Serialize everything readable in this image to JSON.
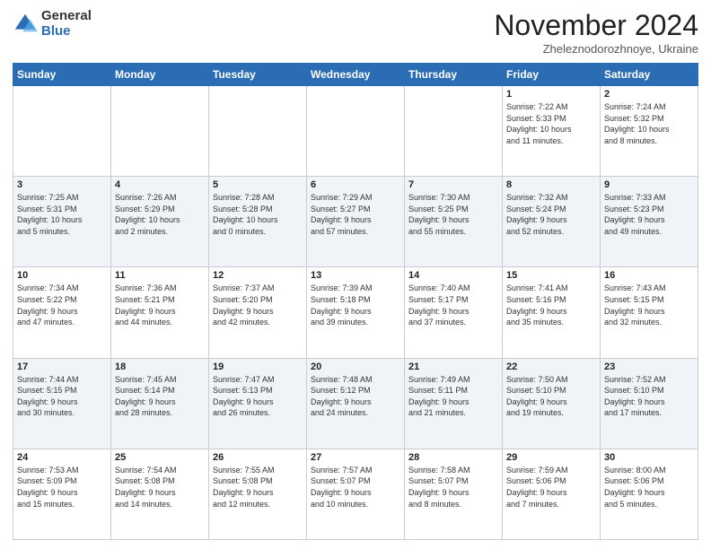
{
  "header": {
    "logo_general": "General",
    "logo_blue": "Blue",
    "month_title": "November 2024",
    "location": "Zheleznodorozhnoye, Ukraine"
  },
  "days_of_week": [
    "Sunday",
    "Monday",
    "Tuesday",
    "Wednesday",
    "Thursday",
    "Friday",
    "Saturday"
  ],
  "weeks": [
    [
      {
        "day": "",
        "info": ""
      },
      {
        "day": "",
        "info": ""
      },
      {
        "day": "",
        "info": ""
      },
      {
        "day": "",
        "info": ""
      },
      {
        "day": "",
        "info": ""
      },
      {
        "day": "1",
        "info": "Sunrise: 7:22 AM\nSunset: 5:33 PM\nDaylight: 10 hours\nand 11 minutes."
      },
      {
        "day": "2",
        "info": "Sunrise: 7:24 AM\nSunset: 5:32 PM\nDaylight: 10 hours\nand 8 minutes."
      }
    ],
    [
      {
        "day": "3",
        "info": "Sunrise: 7:25 AM\nSunset: 5:31 PM\nDaylight: 10 hours\nand 5 minutes."
      },
      {
        "day": "4",
        "info": "Sunrise: 7:26 AM\nSunset: 5:29 PM\nDaylight: 10 hours\nand 2 minutes."
      },
      {
        "day": "5",
        "info": "Sunrise: 7:28 AM\nSunset: 5:28 PM\nDaylight: 10 hours\nand 0 minutes."
      },
      {
        "day": "6",
        "info": "Sunrise: 7:29 AM\nSunset: 5:27 PM\nDaylight: 9 hours\nand 57 minutes."
      },
      {
        "day": "7",
        "info": "Sunrise: 7:30 AM\nSunset: 5:25 PM\nDaylight: 9 hours\nand 55 minutes."
      },
      {
        "day": "8",
        "info": "Sunrise: 7:32 AM\nSunset: 5:24 PM\nDaylight: 9 hours\nand 52 minutes."
      },
      {
        "day": "9",
        "info": "Sunrise: 7:33 AM\nSunset: 5:23 PM\nDaylight: 9 hours\nand 49 minutes."
      }
    ],
    [
      {
        "day": "10",
        "info": "Sunrise: 7:34 AM\nSunset: 5:22 PM\nDaylight: 9 hours\nand 47 minutes."
      },
      {
        "day": "11",
        "info": "Sunrise: 7:36 AM\nSunset: 5:21 PM\nDaylight: 9 hours\nand 44 minutes."
      },
      {
        "day": "12",
        "info": "Sunrise: 7:37 AM\nSunset: 5:20 PM\nDaylight: 9 hours\nand 42 minutes."
      },
      {
        "day": "13",
        "info": "Sunrise: 7:39 AM\nSunset: 5:18 PM\nDaylight: 9 hours\nand 39 minutes."
      },
      {
        "day": "14",
        "info": "Sunrise: 7:40 AM\nSunset: 5:17 PM\nDaylight: 9 hours\nand 37 minutes."
      },
      {
        "day": "15",
        "info": "Sunrise: 7:41 AM\nSunset: 5:16 PM\nDaylight: 9 hours\nand 35 minutes."
      },
      {
        "day": "16",
        "info": "Sunrise: 7:43 AM\nSunset: 5:15 PM\nDaylight: 9 hours\nand 32 minutes."
      }
    ],
    [
      {
        "day": "17",
        "info": "Sunrise: 7:44 AM\nSunset: 5:15 PM\nDaylight: 9 hours\nand 30 minutes."
      },
      {
        "day": "18",
        "info": "Sunrise: 7:45 AM\nSunset: 5:14 PM\nDaylight: 9 hours\nand 28 minutes."
      },
      {
        "day": "19",
        "info": "Sunrise: 7:47 AM\nSunset: 5:13 PM\nDaylight: 9 hours\nand 26 minutes."
      },
      {
        "day": "20",
        "info": "Sunrise: 7:48 AM\nSunset: 5:12 PM\nDaylight: 9 hours\nand 24 minutes."
      },
      {
        "day": "21",
        "info": "Sunrise: 7:49 AM\nSunset: 5:11 PM\nDaylight: 9 hours\nand 21 minutes."
      },
      {
        "day": "22",
        "info": "Sunrise: 7:50 AM\nSunset: 5:10 PM\nDaylight: 9 hours\nand 19 minutes."
      },
      {
        "day": "23",
        "info": "Sunrise: 7:52 AM\nSunset: 5:10 PM\nDaylight: 9 hours\nand 17 minutes."
      }
    ],
    [
      {
        "day": "24",
        "info": "Sunrise: 7:53 AM\nSunset: 5:09 PM\nDaylight: 9 hours\nand 15 minutes."
      },
      {
        "day": "25",
        "info": "Sunrise: 7:54 AM\nSunset: 5:08 PM\nDaylight: 9 hours\nand 14 minutes."
      },
      {
        "day": "26",
        "info": "Sunrise: 7:55 AM\nSunset: 5:08 PM\nDaylight: 9 hours\nand 12 minutes."
      },
      {
        "day": "27",
        "info": "Sunrise: 7:57 AM\nSunset: 5:07 PM\nDaylight: 9 hours\nand 10 minutes."
      },
      {
        "day": "28",
        "info": "Sunrise: 7:58 AM\nSunset: 5:07 PM\nDaylight: 9 hours\nand 8 minutes."
      },
      {
        "day": "29",
        "info": "Sunrise: 7:59 AM\nSunset: 5:06 PM\nDaylight: 9 hours\nand 7 minutes."
      },
      {
        "day": "30",
        "info": "Sunrise: 8:00 AM\nSunset: 5:06 PM\nDaylight: 9 hours\nand 5 minutes."
      }
    ]
  ]
}
